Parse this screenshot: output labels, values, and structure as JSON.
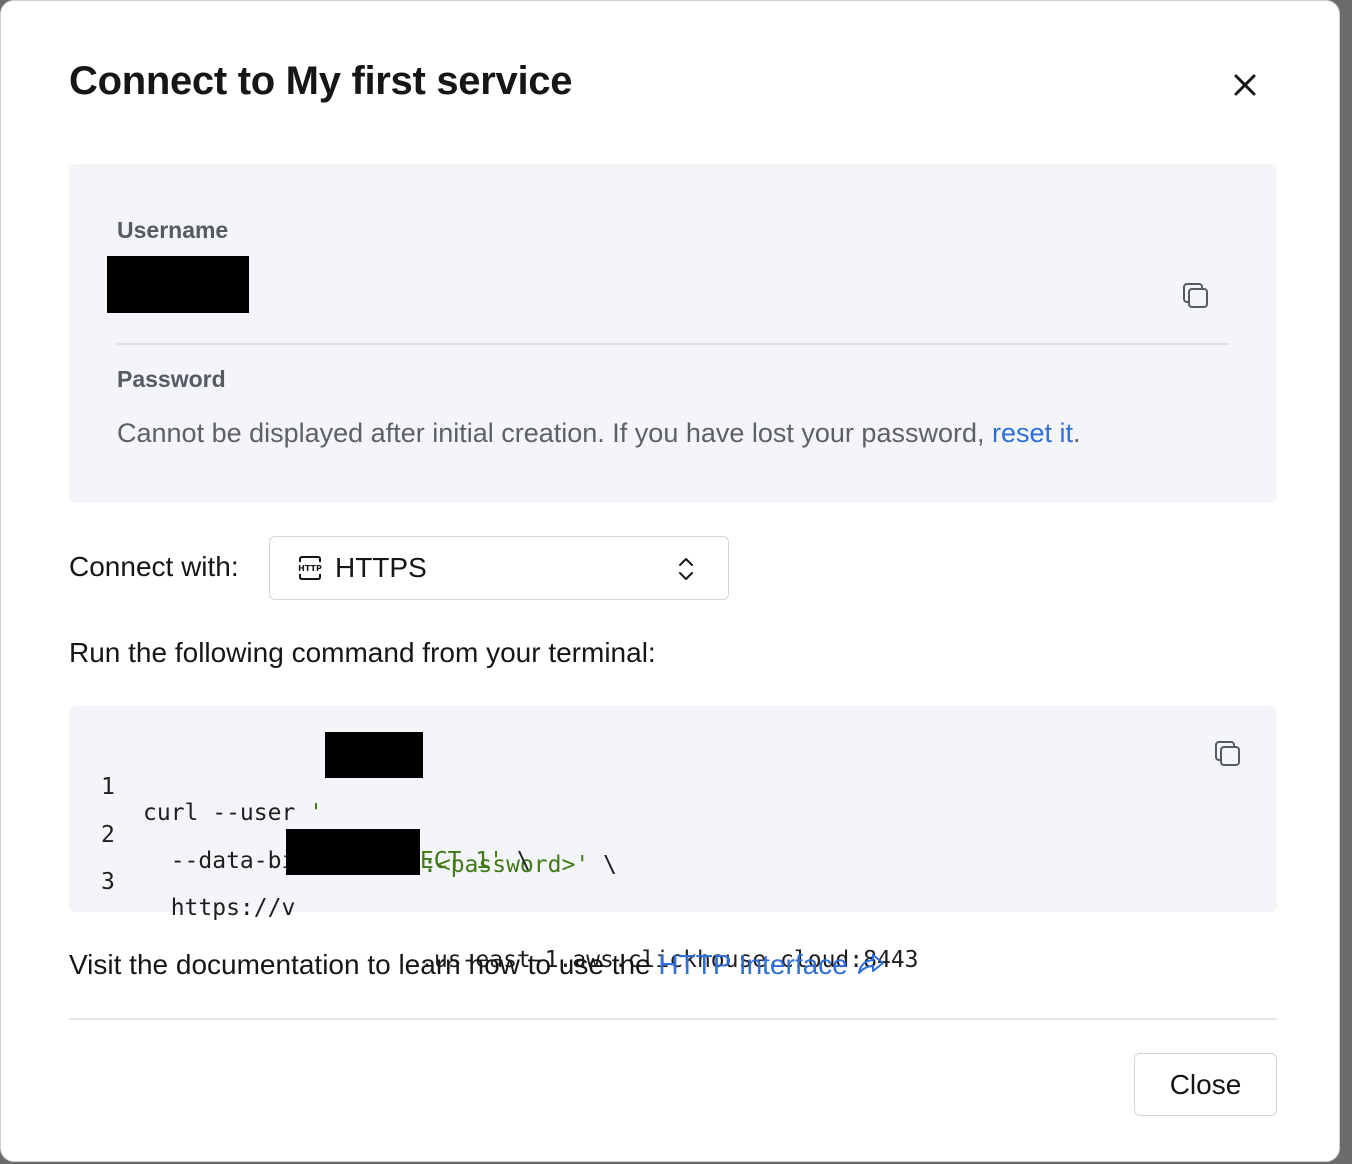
{
  "dialog": {
    "title": "Connect to My first service",
    "close_icon": "close-icon"
  },
  "credentials": {
    "username_label": "Username",
    "password_label": "Password",
    "password_message": "Cannot be displayed after initial creation. If you have lost your password, ",
    "reset_link": "reset it",
    "password_message_end": ".",
    "copy_icon": "copy-icon"
  },
  "connect": {
    "label": "Connect with:",
    "selected": "HTTPS",
    "selected_icon": "http-icon",
    "chevron_icon": "chevron-up-down-icon"
  },
  "instructions": {
    "run_text": "Run the following command from your terminal:"
  },
  "code": {
    "lines": [
      {
        "num": "1",
        "pre": "curl --user ",
        "str_open": "'",
        "str_rest": ":<password>'",
        "post": " \\"
      },
      {
        "num": "2",
        "pre": "  --data-binary ",
        "str": "'SELECT 1'",
        "post": " \\"
      },
      {
        "num": "3",
        "pre": "  https://",
        "mid": "v",
        "post": ".us-east-1.aws.clickhouse.cloud:8443"
      }
    ],
    "copy_icon": "copy-icon"
  },
  "docs": {
    "text": "Visit the documentation to learn how to use the ",
    "link": "HTTP Interface",
    "link_icon": "external-link-icon"
  },
  "footer": {
    "close_label": "Close"
  },
  "colors": {
    "link": "#2f6fd8",
    "code_string": "#3f7a17",
    "panel_bg": "#f4f5f8"
  }
}
